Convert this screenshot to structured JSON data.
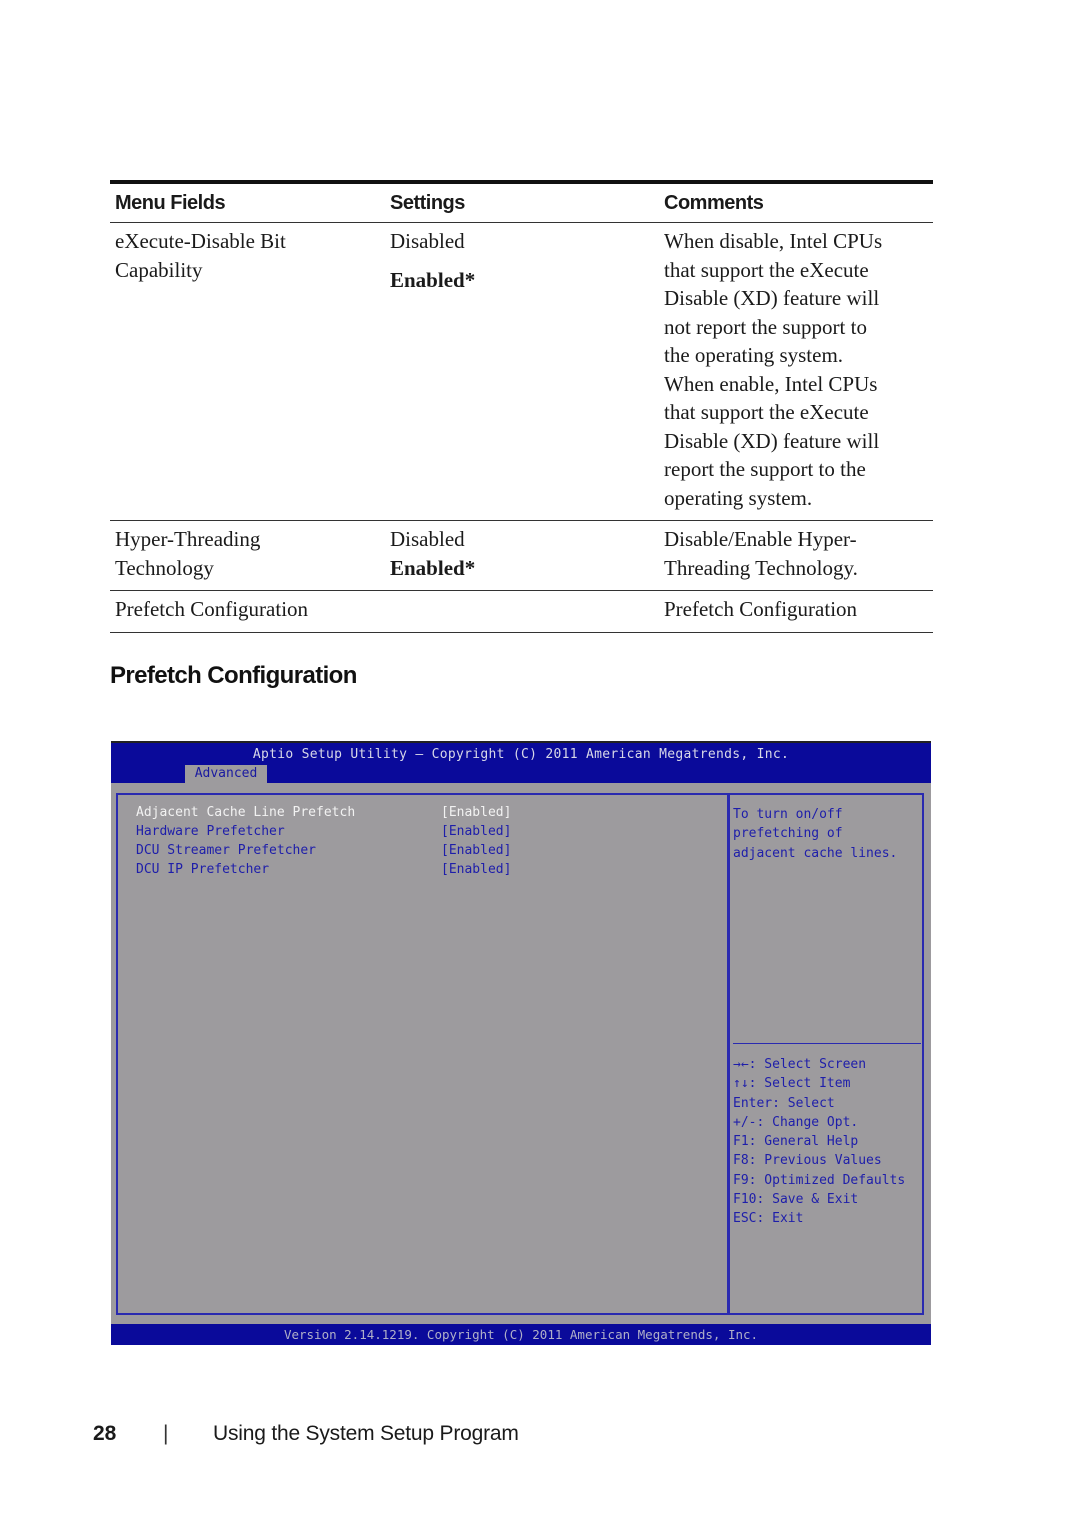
{
  "table": {
    "headers": [
      "Menu Fields",
      "Settings",
      "Comments"
    ],
    "rows": [
      {
        "field": [
          "eXecute-Disable Bit",
          "Capability"
        ],
        "settings": {
          "option1": "Disabled",
          "option2": "Enabled*"
        },
        "comment": [
          "When disable, Intel CPUs",
          "that support the eXecute",
          "Disable (XD) feature will",
          "not report the support to",
          "the operating system.",
          "When enable, Intel CPUs",
          "that support the eXecute",
          "Disable (XD) feature will",
          "report the support to the",
          "operating system."
        ]
      },
      {
        "field": [
          "Hyper-Threading",
          "Technology"
        ],
        "settings": {
          "option1": "Disabled",
          "option2": "Enabled*"
        },
        "comment": [
          "Disable/Enable Hyper-",
          "Threading Technology."
        ]
      },
      {
        "field": [
          "Prefetch Configuration"
        ],
        "settings": {
          "option1": "",
          "option2": ""
        },
        "comment": [
          "Prefetch Configuration"
        ]
      }
    ]
  },
  "section_title": "Prefetch Configuration",
  "bios": {
    "title": "Aptio Setup Utility – Copyright (C) 2011 American Megatrends, Inc.",
    "active_tab": "Advanced",
    "items": [
      {
        "label": "Adjacent Cache Line Prefetch",
        "value": "[Enabled]",
        "selected": true
      },
      {
        "label": "Hardware Prefetcher",
        "value": "[Enabled]",
        "selected": false
      },
      {
        "label": "DCU Streamer Prefetcher",
        "value": "[Enabled]",
        "selected": false
      },
      {
        "label": "DCU IP Prefetcher",
        "value": "[Enabled]",
        "selected": false
      }
    ],
    "help_lines": [
      "To turn on/off",
      "prefetching of",
      "adjacent cache lines."
    ],
    "key_help": [
      "→←: Select Screen",
      "↑↓: Select Item",
      "Enter: Select",
      "+/-: Change Opt.",
      "F1: General Help",
      "F8: Previous Values",
      "F9: Optimized Defaults",
      "F10: Save & Exit",
      "ESC: Exit"
    ],
    "footer": "Version 2.14.1219. Copyright (C) 2011 American Megatrends, Inc.",
    "colors": {
      "header_bg": "#0a0a9a",
      "panel_bg": "#9d9b9e",
      "item_text": "#1e1eaa",
      "selected_text": "#f2f2f2"
    }
  },
  "page_footer": {
    "page_number": "28",
    "separator": "|",
    "running_head": "Using the System Setup Program"
  }
}
